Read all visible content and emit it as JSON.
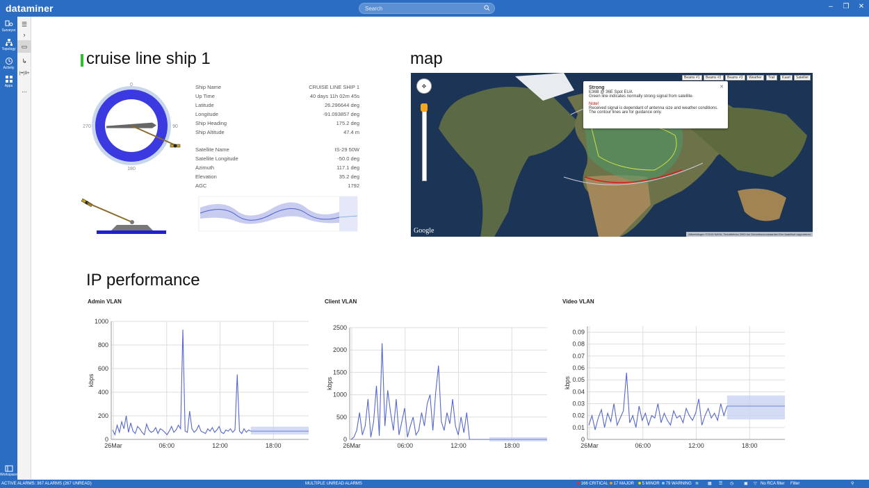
{
  "app": {
    "title": "dataminer",
    "search_placeholder": "Search"
  },
  "nav": [
    {
      "id": "surveyor",
      "label": "Surveyor"
    },
    {
      "id": "topology",
      "label": "Topology"
    },
    {
      "id": "activity",
      "label": "Activity"
    },
    {
      "id": "apps",
      "label": "Apps"
    },
    {
      "id": "workspace",
      "label": "Workspace"
    }
  ],
  "subnav": {
    "badge": "(••)9+",
    "more": "..."
  },
  "ship": {
    "title": "cruise line ship 1",
    "compass": {
      "n": "0",
      "e": "90",
      "s": "180",
      "w": "270",
      "heading_deg": 175.2,
      "azimuth_deg": 117.1
    },
    "rows": [
      {
        "label": "Ship Name",
        "value": "CRUISE LINE SHIP 1"
      },
      {
        "label": "Up Time",
        "value": "40 days 11h 02m 45s"
      },
      {
        "label": "Latitude",
        "value": "26.296644 deg"
      },
      {
        "label": "Longitude",
        "value": "-91.093857 deg"
      },
      {
        "label": "Ship Heading",
        "value": "175.2 deg"
      },
      {
        "label": "Ship Altitude",
        "value": "47.4 m"
      },
      {
        "label": "Satellite Name",
        "value": "IS-29 50W"
      },
      {
        "label": "Satellite Longitude",
        "value": "-50.0 deg"
      },
      {
        "label": "Azimuth",
        "value": "117.1 deg"
      },
      {
        "label": "Elevation",
        "value": "35.2 deg"
      },
      {
        "label": "AGC",
        "value": "1792"
      }
    ]
  },
  "map": {
    "title": "map",
    "buttons": [
      "Beams #1",
      "Beams #2",
      "Beams #3",
      "Weather",
      "Trail",
      "Kaart",
      "Satelliet"
    ],
    "popup": {
      "heading": "Strong",
      "subheading": "E36B @ 36E Spot EUA",
      "line1": "Green line indicates normally strong signal from satellite.",
      "note": "Note!",
      "line2": "Received signal is dependant of antenna size and weather conditions.",
      "line3": "The contour lines are for guidance only."
    },
    "google": "Google",
    "attribution": "Afbeeldingen ©2015 NASA, TerraMetrics   2000 km   Gebruiksvoorwaarden   Een kaartfout rapporteren"
  },
  "ip": {
    "title": "IP performance"
  },
  "chart_data": [
    {
      "type": "line",
      "title": "Admin VLAN",
      "ylabel": "kbps",
      "yticks": [
        0,
        200,
        400,
        600,
        800,
        1000
      ],
      "ylim": [
        0,
        1000
      ],
      "xticks": [
        "26Mar",
        "06:00",
        "12:00",
        "18:00"
      ],
      "series": [
        {
          "values": [
            80,
            40,
            120,
            60,
            150,
            90,
            200,
            60,
            140,
            70,
            50,
            110,
            90,
            60,
            40,
            130,
            80,
            60,
            70,
            100,
            50,
            90,
            80,
            60,
            40,
            70,
            110,
            60,
            80,
            120,
            90,
            930,
            70,
            60,
            240,
            90,
            60,
            80,
            120,
            70,
            60,
            50,
            90,
            70,
            100,
            60,
            80,
            110,
            60,
            50,
            80,
            70,
            90,
            60,
            80,
            550,
            70,
            50,
            90,
            60,
            80,
            70
          ]
        }
      ]
    },
    {
      "type": "line",
      "title": "Client VLAN",
      "ylabel": "kbps",
      "yticks": [
        0,
        500,
        1000,
        1500,
        2000,
        2500
      ],
      "ylim": [
        0,
        2500
      ],
      "xticks": [
        "26Mar",
        "06:00",
        "12:00",
        "18:00"
      ],
      "series": [
        {
          "values": [
            0,
            50,
            200,
            600,
            100,
            300,
            900,
            50,
            400,
            1200,
            80,
            2150,
            300,
            1100,
            600,
            200,
            900,
            100,
            400,
            700,
            50,
            300,
            500,
            100,
            200,
            600,
            300,
            800,
            1000,
            200,
            1050,
            1650,
            400,
            200,
            600,
            350,
            900,
            300,
            100,
            500,
            150,
            600,
            0,
            0,
            0,
            0,
            0,
            0,
            0,
            0
          ]
        }
      ]
    },
    {
      "type": "line",
      "title": "Video VLAN",
      "ylabel": "kbps",
      "yticks": [
        0,
        0.01,
        0.02,
        0.03,
        0.04,
        0.05,
        0.06,
        0.07,
        0.08,
        0.09
      ],
      "ylim": [
        0,
        0.095
      ],
      "xticks": [
        "26Mar",
        "06:00",
        "12:00",
        "18:00"
      ],
      "series": [
        {
          "values": [
            0.012,
            0.02,
            0.008,
            0.018,
            0.025,
            0.01,
            0.022,
            0.015,
            0.03,
            0.012,
            0.018,
            0.024,
            0.056,
            0.014,
            0.02,
            0.01,
            0.028,
            0.016,
            0.022,
            0.012,
            0.02,
            0.018,
            0.03,
            0.014,
            0.022,
            0.016,
            0.012,
            0.024,
            0.018,
            0.02,
            0.014,
            0.026,
            0.02,
            0.016,
            0.022,
            0.034,
            0.012,
            0.02,
            0.026,
            0.018,
            0.022,
            0.016,
            0.03,
            0.02,
            0.028
          ]
        }
      ]
    }
  ],
  "statusbar": {
    "alarms": "ACTIVE ALARMS: 367 ALARMS (267 UNREAD)",
    "multiple": "MULTIPLE UNREAD ALARMS",
    "critical": "166 CRITICAL",
    "major": "17 MAJOR",
    "minor": "5 MINOR",
    "warning": "79 WARNING",
    "rca": "No RCA filter",
    "filter": "Filter",
    "colors": {
      "critical": "#e03030",
      "major": "#f39c12",
      "minor": "#f1d000",
      "warning": "#8ecbf0"
    }
  }
}
